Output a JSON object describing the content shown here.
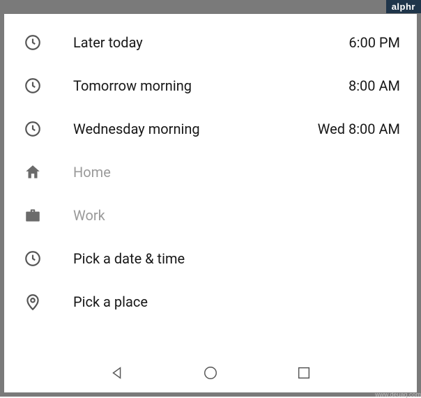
{
  "badge": "alphr",
  "options": [
    {
      "icon": "clock-icon",
      "label": "Later today",
      "value": "6:00 PM",
      "dim": false
    },
    {
      "icon": "clock-icon",
      "label": "Tomorrow morning",
      "value": "8:00 AM",
      "dim": false
    },
    {
      "icon": "clock-icon",
      "label": "Wednesday morning",
      "value": "Wed 8:00 AM",
      "dim": false
    },
    {
      "icon": "home-icon",
      "label": "Home",
      "value": "",
      "dim": true
    },
    {
      "icon": "briefcase-icon",
      "label": "Work",
      "value": "",
      "dim": true
    },
    {
      "icon": "clock-icon",
      "label": "Pick a date & time",
      "value": "",
      "dim": false
    },
    {
      "icon": "pin-icon",
      "label": "Pick a place",
      "value": "",
      "dim": false
    }
  ],
  "watermark": "www.deuaq.com"
}
